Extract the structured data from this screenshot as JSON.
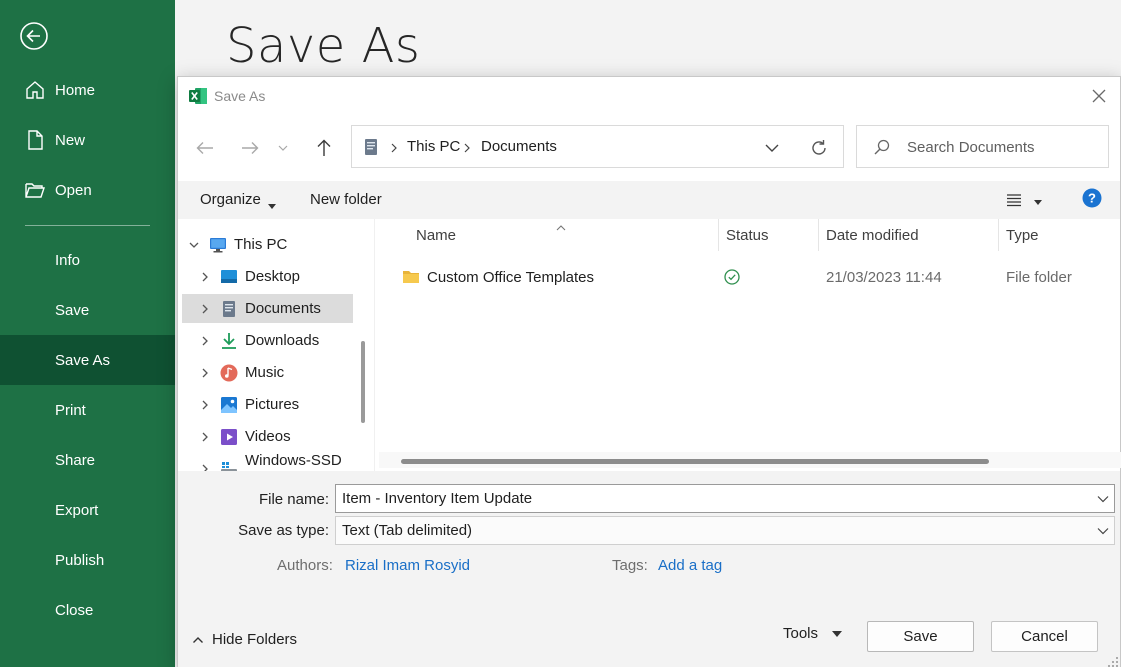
{
  "backstage": {
    "title": "Save As",
    "nav": {
      "home": "Home",
      "new": "New",
      "open": "Open",
      "info": "Info",
      "save": "Save",
      "save_as": "Save As",
      "print": "Print",
      "share": "Share",
      "export": "Export",
      "publish": "Publish",
      "close": "Close"
    },
    "accent_color": "#1e7145",
    "active_color": "#0f5132"
  },
  "dialog": {
    "title": "Save As",
    "address": [
      "This PC",
      "Documents"
    ],
    "search_placeholder": "Search Documents",
    "toolbar": {
      "organize": "Organize",
      "new_folder": "New folder"
    },
    "tree": [
      {
        "label": "This PC",
        "icon": "computer-icon"
      },
      {
        "label": "Desktop",
        "icon": "desktop-icon"
      },
      {
        "label": "Documents",
        "icon": "documents-icon"
      },
      {
        "label": "Downloads",
        "icon": "downloads-icon"
      },
      {
        "label": "Music",
        "icon": "music-icon"
      },
      {
        "label": "Pictures",
        "icon": "pictures-icon"
      },
      {
        "label": "Videos",
        "icon": "videos-icon"
      },
      {
        "label": "Windows-SSD (C",
        "icon": "drive-icon"
      }
    ],
    "columns": {
      "name": "Name",
      "status": "Status",
      "date": "Date modified",
      "type": "Type"
    },
    "files": [
      {
        "name": "Custom Office Templates",
        "status": "synced",
        "date": "21/03/2023 11:44",
        "type": "File folder"
      }
    ],
    "form": {
      "file_name_label": "File name:",
      "file_name": "Item - Inventory Item Update",
      "save_type_label": "Save as type:",
      "save_type": "Text (Tab delimited)",
      "authors_label": "Authors:",
      "authors": "Rizal Imam Rosyid",
      "tags_label": "Tags:",
      "tags": "Add a tag"
    },
    "footer": {
      "hide_folders": "Hide Folders",
      "tools": "Tools",
      "save": "Save",
      "cancel": "Cancel"
    }
  }
}
